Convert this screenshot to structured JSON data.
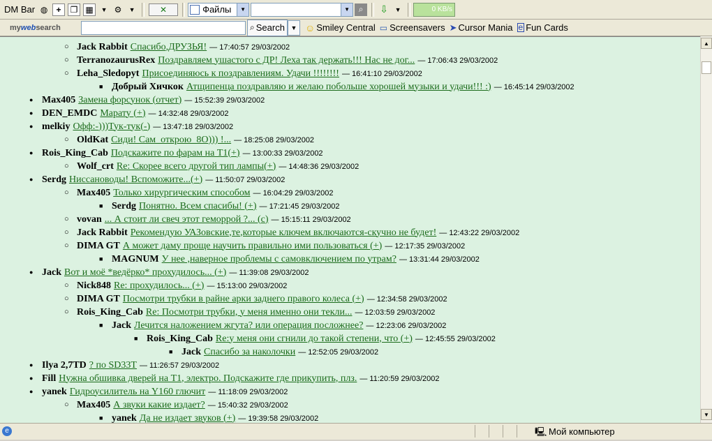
{
  "toolbar": {
    "dm_bar_label": "DM Bar",
    "files_label": "Файлы",
    "speed": "0 KB/s"
  },
  "search_bar": {
    "brand_my": "my",
    "brand_web": "web",
    "brand_search": "search",
    "query_value": "",
    "search_button": "Search",
    "links": [
      "Smiley Central",
      "Screensavers",
      "Cursor Mania",
      "Fun Cards"
    ]
  },
  "thread": [
    {
      "level": 2,
      "author": "Jack Rabbit",
      "subject": "Спасибо,ДРУЗЬЯ!",
      "time": "17:40:57",
      "date": "29/03/2002"
    },
    {
      "level": 2,
      "author": "TerranozaurusRex",
      "subject": "Поздравляем ушастого с ДР! Леха так держать!!! Нас не дог...",
      "time": "17:06:43",
      "date": "29/03/2002"
    },
    {
      "level": 2,
      "author": "Leha_Sledopyt",
      "subject": "Присоединяюсь к поздравлениям. Удачи !!!!!!!!",
      "time": "16:41:10",
      "date": "29/03/2002"
    },
    {
      "level": 3,
      "author": "Добрый Хичкок",
      "subject": "Атщипенца поздравляю и желаю побольше хорошей музыки и удачи!!! :)",
      "time": "16:45:14",
      "date": "29/03/2002"
    },
    {
      "level": 1,
      "author": "Max405",
      "subject": "Замена форсунок (отчет)",
      "time": "15:52:39",
      "date": "29/03/2002"
    },
    {
      "level": 1,
      "author": "DEN_EMDC",
      "subject": "Марату (+)",
      "time": "14:32:48",
      "date": "29/03/2002"
    },
    {
      "level": 1,
      "author": "melkiy",
      "subject": "Офф:-)))Тук-тук(-)",
      "time": "13:47:18",
      "date": "29/03/2002"
    },
    {
      "level": 2,
      "author": "OldKat",
      "subject": "Сиди! Сам_открою_8О))) !...",
      "time": "18:25:08",
      "date": "29/03/2002"
    },
    {
      "level": 1,
      "author": "Rois_King_Cab",
      "subject": "Подскажите по фарам на T1(+)",
      "time": "13:00:33",
      "date": "29/03/2002"
    },
    {
      "level": 2,
      "author": "Wolf_crt",
      "subject": "Re: Скорее всего другой тип лампы(+)",
      "time": "14:48:36",
      "date": "29/03/2002"
    },
    {
      "level": 1,
      "author": "Serdg",
      "subject": "Ниссановоды! Вспоможите...(+)",
      "time": "11:50:07",
      "date": "29/03/2002"
    },
    {
      "level": 2,
      "author": "Max405",
      "subject": "Только хирургическим способом",
      "time": "16:04:29",
      "date": "29/03/2002"
    },
    {
      "level": 3,
      "author": "Serdg",
      "subject": "Понятно. Всем спасибы! (+)",
      "time": "17:21:45",
      "date": "29/03/2002"
    },
    {
      "level": 2,
      "author": "vovan",
      "subject": "... А стоит ли свеч этот геморрой ?... (с)",
      "time": "15:15:11",
      "date": "29/03/2002"
    },
    {
      "level": 2,
      "author": "Jack Rabbit",
      "subject": "Рекомендую УАЗовские,те,которые ключем включаются-скучно не будет!",
      "time": "12:43:22",
      "date": "29/03/2002"
    },
    {
      "level": 2,
      "author": "DIMA GT",
      "subject": "А может даму проще научить правильно ими пользоваться (+)",
      "time": "12:17:35",
      "date": "29/03/2002"
    },
    {
      "level": 3,
      "author": "MAGNUM",
      "subject": "У нее ,наверное проблемы с самовключением по утрам?",
      "time": "13:31:44",
      "date": "29/03/2002"
    },
    {
      "level": 1,
      "author": "Jack",
      "subject": "Вот и моё *ведёрко* прохудилось... (+)",
      "time": "11:39:08",
      "date": "29/03/2002"
    },
    {
      "level": 2,
      "author": "Nick848",
      "subject": "Re: прохудилось... (+)",
      "time": "15:13:00",
      "date": "29/03/2002"
    },
    {
      "level": 2,
      "author": "DIMA GT",
      "subject": "Посмотри трубки в райне арки заднего правого колеса (+)",
      "time": "12:34:58",
      "date": "29/03/2002"
    },
    {
      "level": 2,
      "author": "Rois_King_Cab",
      "subject": "Re: Посмотри трубки, у меня именно они текли...",
      "time": "12:03:59",
      "date": "29/03/2002"
    },
    {
      "level": 3,
      "author": "Jack",
      "subject": "Лечится наложением жгута? или операция посложнее?",
      "time": "12:23:06",
      "date": "29/03/2002"
    },
    {
      "level": 4,
      "author": "Rois_King_Cab",
      "subject": "Re:у меня они сгнили до такой степени, что (+)",
      "time": "12:45:55",
      "date": "29/03/2002"
    },
    {
      "level": 5,
      "author": "Jack",
      "subject": "Спасибо за наколочки",
      "time": "12:52:05",
      "date": "29/03/2002"
    },
    {
      "level": 1,
      "author": "Ilya 2,7TD",
      "subject": "? по SD33T",
      "time": "11:26:57",
      "date": "29/03/2002"
    },
    {
      "level": 1,
      "author": "Fill",
      "subject": "Нужна обшивка дверей на T1, электро. Подскажите где прикупить, плз.",
      "time": "11:20:59",
      "date": "29/03/2002"
    },
    {
      "level": 1,
      "author": "yanek",
      "subject": "Гидроусилитель на Y160 глючит",
      "time": "11:18:09",
      "date": "29/03/2002"
    },
    {
      "level": 2,
      "author": "Max405",
      "subject": "А звуки какие издает?",
      "time": "15:40:32",
      "date": "29/03/2002"
    },
    {
      "level": 3,
      "author": "yanek",
      "subject": "Да не издает звуков (+)",
      "time": "19:39:58",
      "date": "29/03/2002"
    }
  ],
  "separator": "—",
  "status_bar": {
    "zone_label": "Мой компьютер"
  }
}
